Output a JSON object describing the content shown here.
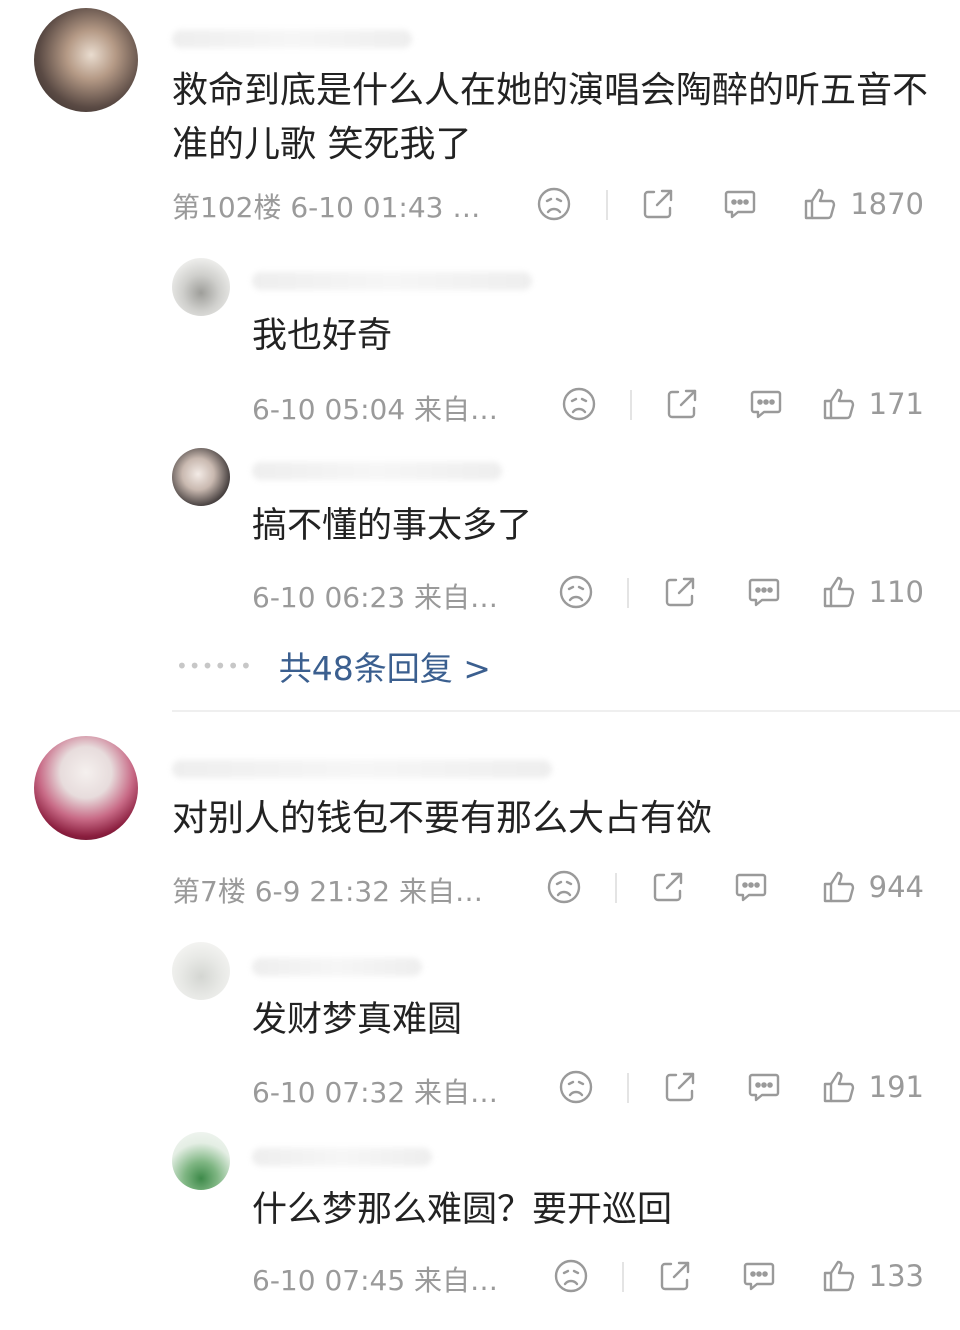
{
  "comments": [
    {
      "text": "救命到底是什么人在她的演唱会陶醉的听五音不准的儿歌 笑死我了",
      "meta": "第102楼 6-10 01:43 …",
      "likes": "1870",
      "replies": [
        {
          "text": "我也好奇",
          "meta": "6-10 05:04 来自…",
          "likes": "171"
        },
        {
          "text": "搞不懂的事太多了",
          "meta": "6-10 06:23 来自…",
          "likes": "110"
        }
      ],
      "more_replies": "共48条回复 >"
    },
    {
      "text": "对别人的钱包不要有那么大占有欲",
      "meta": "第7楼 6-9 21:32 来自…",
      "likes": "944",
      "replies": [
        {
          "text": "发财梦真难圆",
          "meta": "6-10 07:32 来自…",
          "likes": "191"
        },
        {
          "text": "什么梦那么难圆？要开巡回",
          "meta": "6-10 07:45 来自…",
          "likes": "133"
        }
      ]
    }
  ],
  "icons": {
    "dislike": "sad-face-icon",
    "share": "share-icon",
    "reply": "comment-icon",
    "like": "thumbs-up-icon"
  },
  "colors": {
    "text": "#222222",
    "meta": "#9a9a9a",
    "link": "#3b5f8f"
  }
}
